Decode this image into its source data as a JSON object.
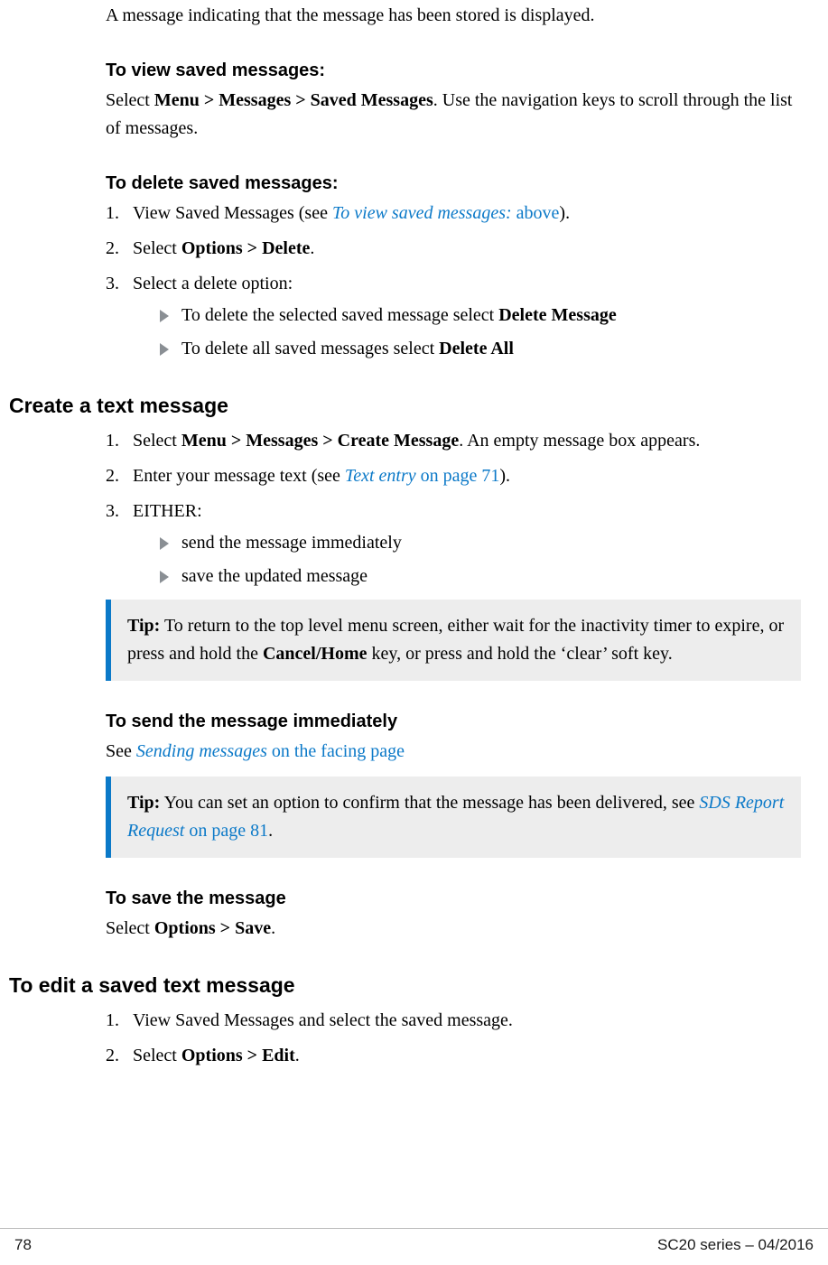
{
  "intro_line": "A message indicating that the message has been stored is displayed.",
  "view_saved": {
    "heading": "To view saved messages:",
    "para_pre": "Select ",
    "para_bold": "Menu > Messages > Saved Messages",
    "para_post": ". Use the navigation keys to scroll through the list of messages."
  },
  "delete_saved": {
    "heading": "To delete saved messages:",
    "items": [
      {
        "num": "1.",
        "pre": "View Saved Messages (see ",
        "xref_ital": "To view saved messages:",
        "xref_rest": " above",
        "post": ")."
      },
      {
        "num": "2.",
        "pre": "Select ",
        "bold": "Options > Delete",
        "post": "."
      },
      {
        "num": "3.",
        "text": "Select a delete option:"
      }
    ],
    "bullets": [
      {
        "pre": "To delete the selected saved message select ",
        "bold": "Delete Message"
      },
      {
        "pre": "To delete all saved messages select ",
        "bold": "Delete All"
      }
    ]
  },
  "create_msg": {
    "heading": "Create a text message",
    "items": [
      {
        "num": "1.",
        "pre": "Select ",
        "bold": "Menu > Messages > Create Message",
        "post": ". An empty message box appears."
      },
      {
        "num": "2.",
        "pre": "Enter your message text (see ",
        "xref_ital": "Text entry",
        "xref_rest": " on page 71",
        "post": ")."
      },
      {
        "num": "3.",
        "text": "EITHER:"
      }
    ],
    "bullets": [
      {
        "text": "send the message immediately"
      },
      {
        "text": "save the updated message"
      }
    ],
    "tip1_label": "Tip:",
    "tip1_pre": "  To return to the top level menu screen, either wait for the inactivity timer to expire, or press and hold the ",
    "tip1_bold": "Cancel/Home",
    "tip1_post": " key, or press and hold the ‘clear’ soft key."
  },
  "send_imm": {
    "heading": "To send the message immediately",
    "see": "See ",
    "xref_ital": "Sending messages",
    "xref_rest": " on the facing page",
    "tip_label": "Tip:",
    "tip_pre": "  You can set an option to confirm that the message has been delivered, see ",
    "tip_xref_ital": "SDS Report Request",
    "tip_xref_rest": " on page 81",
    "tip_post": "."
  },
  "save_msg": {
    "heading": "To save the message",
    "pre": "Select ",
    "bold": "Options > Save",
    "post": "."
  },
  "edit_saved": {
    "heading": "To edit a saved text message",
    "items": [
      {
        "num": "1.",
        "text": "View Saved Messages and select the saved message."
      },
      {
        "num": "2.",
        "pre": "Select ",
        "bold": "Options > Edit",
        "post": "."
      }
    ]
  },
  "footer": {
    "page_no": "78",
    "doc_id": "SC20 series – 04/2016"
  }
}
